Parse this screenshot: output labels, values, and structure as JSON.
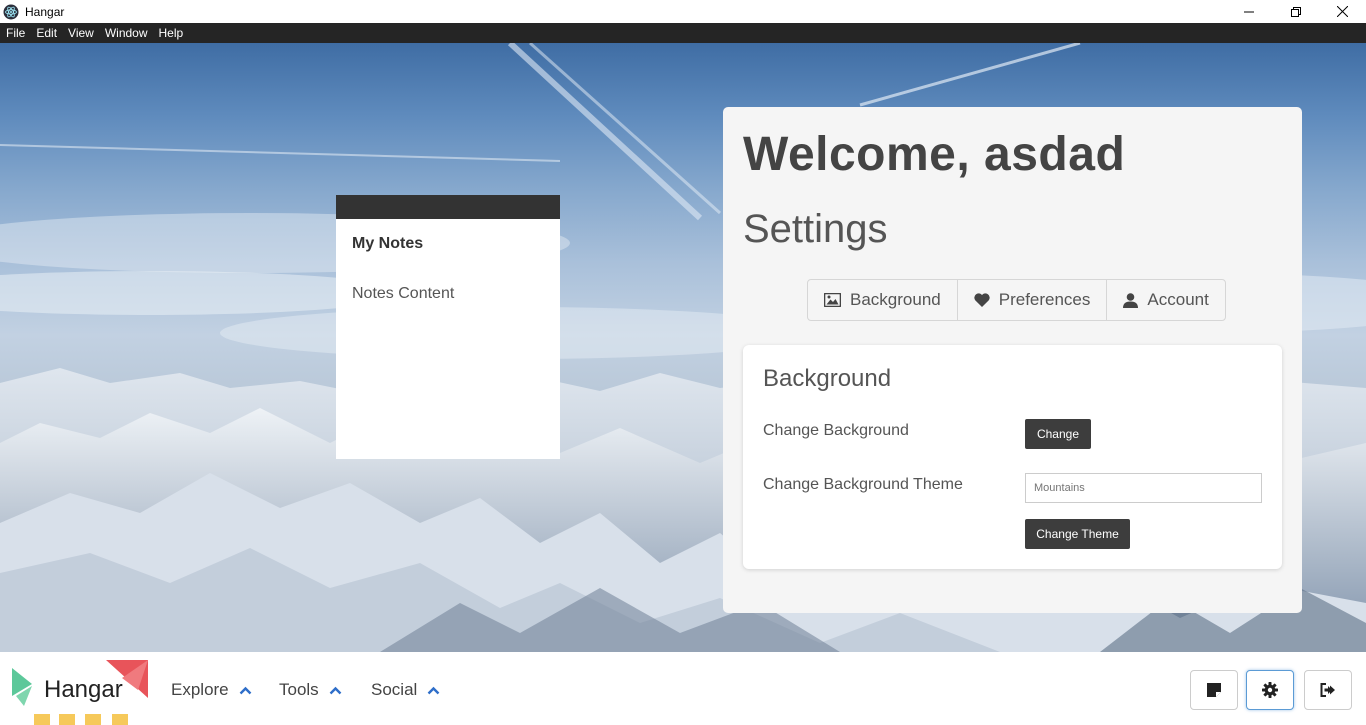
{
  "window": {
    "title": "Hangar"
  },
  "menu": [
    "File",
    "Edit",
    "View",
    "Window",
    "Help"
  ],
  "notes": {
    "title": "My Notes",
    "content": "Notes Content"
  },
  "settings": {
    "welcome": "Welcome, asdad",
    "heading": "Settings",
    "tabs": [
      {
        "label": "Background",
        "icon": "image-icon"
      },
      {
        "label": "Preferences",
        "icon": "heart-icon"
      },
      {
        "label": "Account",
        "icon": "user-icon"
      }
    ],
    "background_card": {
      "title": "Background",
      "change_background_label": "Change Background",
      "change_button": "Change",
      "change_theme_label": "Change Background Theme",
      "theme_placeholder": "Mountains",
      "change_theme_button": "Change Theme"
    }
  },
  "bottombar": {
    "logo_text": "Hangar",
    "nav": [
      {
        "label": "Explore"
      },
      {
        "label": "Tools"
      },
      {
        "label": "Social"
      }
    ],
    "buttons": [
      {
        "icon": "note-icon"
      },
      {
        "icon": "gear-icon"
      },
      {
        "icon": "logout-icon"
      }
    ]
  },
  "colors": {
    "menubar": "#252525",
    "dark_button": "#3d3d3d",
    "accent_blue": "#2e6ec9",
    "logo_red": "#e8545a",
    "logo_green": "#5cc89a",
    "logo_yellow": "#f6c95a"
  }
}
